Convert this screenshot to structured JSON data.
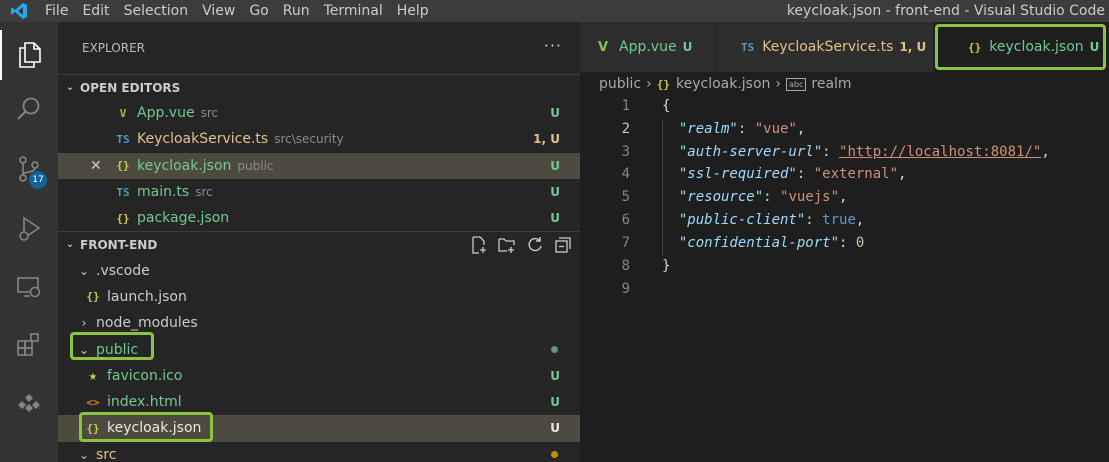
{
  "titlebar": {
    "menu": [
      "File",
      "Edit",
      "Selection",
      "View",
      "Go",
      "Run",
      "Terminal",
      "Help"
    ],
    "window_title": "keycloak.json - front-end - Visual Studio Code"
  },
  "activity_bar": {
    "items": [
      "explorer-icon",
      "search-icon",
      "source-control-icon",
      "run-debug-icon",
      "remote-explorer-icon",
      "extensions-icon",
      "kubernetes-icon"
    ],
    "scm_badge": "17"
  },
  "sidebar": {
    "title": "EXPLORER",
    "more": "···",
    "open_editors": {
      "title": "OPEN EDITORS",
      "items": [
        {
          "icon": "V",
          "name": "App.vue",
          "desc": "src",
          "status": "U"
        },
        {
          "icon": "TS",
          "name": "KeycloakService.ts",
          "desc": "src\\security",
          "status": "1, U"
        },
        {
          "icon": "{}",
          "name": "keycloak.json",
          "desc": "public",
          "status": "U"
        },
        {
          "icon": "TS",
          "name": "main.ts",
          "desc": "src",
          "status": "U"
        },
        {
          "icon": "{}",
          "name": "package.json",
          "desc": "",
          "status": "U"
        }
      ]
    },
    "front_end": {
      "title": "FRONT-END",
      "tree": [
        {
          "name": ".vscode",
          "kind": "folder-open",
          "status": ""
        },
        {
          "name": "launch.json",
          "kind": "json",
          "status": ""
        },
        {
          "name": "node_modules",
          "kind": "folder-closed",
          "status": ""
        },
        {
          "name": "public",
          "kind": "folder-open",
          "status": "dot"
        },
        {
          "name": "favicon.ico",
          "kind": "star",
          "status": "U"
        },
        {
          "name": "index.html",
          "kind": "html",
          "status": "U"
        },
        {
          "name": "keycloak.json",
          "kind": "json",
          "status": "U"
        },
        {
          "name": "src",
          "kind": "folder-open",
          "status": "dot"
        }
      ]
    }
  },
  "tabs": [
    {
      "icon": "V",
      "label": "App.vue",
      "status": "U"
    },
    {
      "icon": "TS",
      "label": "KeycloakService.ts",
      "status": "1, U"
    },
    {
      "icon": "{}",
      "label": "keycloak.json",
      "status": "U"
    }
  ],
  "breadcrumb": [
    "public",
    "keycloak.json",
    "realm"
  ],
  "editor": {
    "line_numbers": [
      "1",
      "2",
      "3",
      "4",
      "5",
      "6",
      "7",
      "8",
      "9"
    ],
    "lines": [
      {
        "open": "{"
      },
      {
        "key": "\"realm\"",
        "value": "\"vue\"",
        "vtype": "s",
        "comma": ","
      },
      {
        "key": "\"auth-server-url\"",
        "value": "\"http://localhost:8081/\"",
        "vtype": "s",
        "comma": ","
      },
      {
        "key": "\"ssl-required\"",
        "value": "\"external\"",
        "vtype": "s",
        "comma": ","
      },
      {
        "key": "\"resource\"",
        "value": "\"vuejs\"",
        "vtype": "s",
        "comma": ","
      },
      {
        "key": "\"public-client\"",
        "value": "true",
        "vtype": "b",
        "comma": ","
      },
      {
        "key": "\"confidential-port\"",
        "value": "0",
        "vtype": "n",
        "comma": ""
      },
      {
        "open": "}"
      },
      {
        "open": ""
      }
    ]
  },
  "colors": {
    "highlight_box": "#8bc53f",
    "untracked_green": "#73c991",
    "modified_yellow": "#e2c08d"
  }
}
